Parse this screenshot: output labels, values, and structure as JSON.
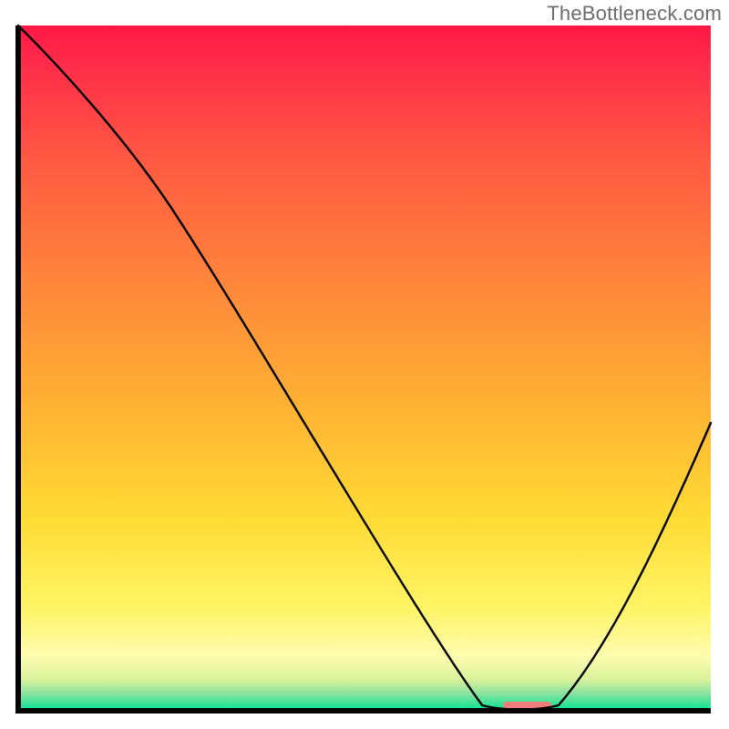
{
  "watermark": "TheBottleneck.com",
  "chart_data": {
    "type": "line",
    "title": "",
    "xlabel": "",
    "ylabel": "",
    "xlim": [
      0,
      100
    ],
    "ylim": [
      0,
      100
    ],
    "x": [
      0,
      23,
      67,
      72,
      78,
      100
    ],
    "y": [
      100,
      72,
      0,
      0,
      0.5,
      42
    ],
    "curve": {
      "description": "Black curve descending from top-left, inflecting around x≈23, reaching a flat trough between x≈67 and x≈78, then rising to the right edge at y≈42.",
      "trough_marker": {
        "x_start": 70,
        "x_end": 77,
        "color": "#f17c7c"
      }
    },
    "background_gradient": {
      "type": "vertical",
      "stops": [
        {
          "offset": 0.0,
          "color": "#ff1744"
        },
        {
          "offset": 0.05,
          "color": "#ff2a4a"
        },
        {
          "offset": 0.2,
          "color": "#ff5a42"
        },
        {
          "offset": 0.4,
          "color": "#ff8c3a"
        },
        {
          "offset": 0.58,
          "color": "#ffb833"
        },
        {
          "offset": 0.72,
          "color": "#ffdb35"
        },
        {
          "offset": 0.85,
          "color": "#fff566"
        },
        {
          "offset": 0.92,
          "color": "#fffcb0"
        },
        {
          "offset": 0.955,
          "color": "#d9f29a"
        },
        {
          "offset": 0.975,
          "color": "#88e2a0"
        },
        {
          "offset": 1.0,
          "color": "#00e490"
        }
      ]
    },
    "frame_color": "#000000"
  }
}
